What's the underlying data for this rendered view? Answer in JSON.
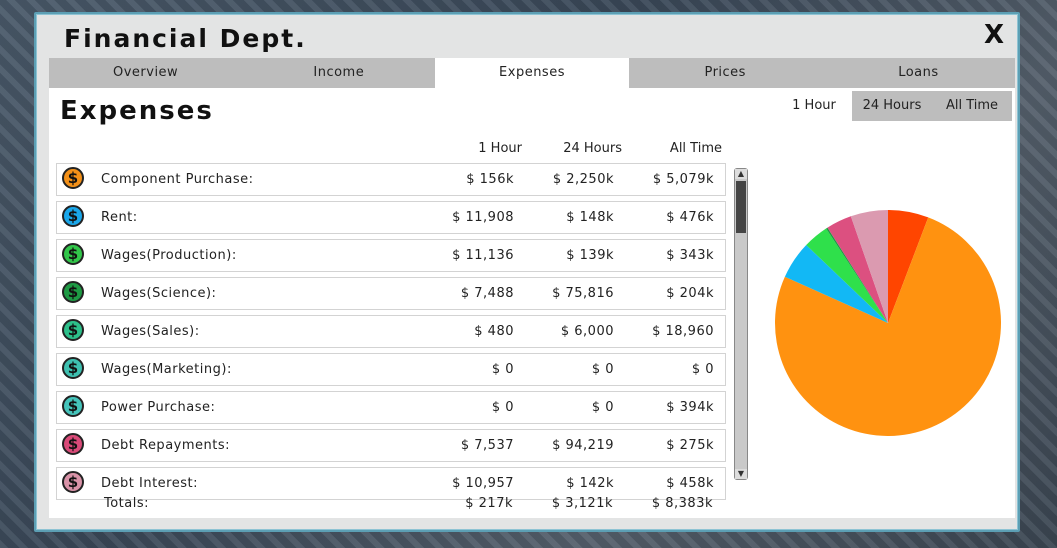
{
  "window": {
    "title": "Financial Dept.",
    "close_label": "X"
  },
  "tabs": [
    "Overview",
    "Income",
    "Expenses",
    "Prices",
    "Loans"
  ],
  "active_tab": "Expenses",
  "heading": "Expenses",
  "period_tabs": [
    "1 Hour",
    "24 Hours",
    "All Time"
  ],
  "active_period": "1 Hour",
  "columns": [
    "1 Hour",
    "24 Hours",
    "All Time"
  ],
  "rows": [
    {
      "label": "Component Purchase:",
      "icon_color": "#f39018",
      "v1": "$ 156k",
      "v2": "$ 2,250k",
      "v3": "$ 5,079k"
    },
    {
      "label": "Rent:",
      "icon_color": "#1aa7ea",
      "v1": "$ 11,908",
      "v2": "$ 148k",
      "v3": "$ 476k"
    },
    {
      "label": "Wages(Production):",
      "icon_color": "#32c64a",
      "v1": "$ 11,136",
      "v2": "$ 139k",
      "v3": "$ 343k"
    },
    {
      "label": "Wages(Science):",
      "icon_color": "#1e9a44",
      "v1": "$ 7,488",
      "v2": "$ 75,816",
      "v3": "$ 204k"
    },
    {
      "label": "Wages(Sales):",
      "icon_color": "#2dbf8a",
      "v1": "$ 480",
      "v2": "$ 6,000",
      "v3": "$ 18,960"
    },
    {
      "label": "Wages(Marketing):",
      "icon_color": "#3ec0b0",
      "v1": "$ 0",
      "v2": "$ 0",
      "v3": "$ 0"
    },
    {
      "label": "Power Purchase:",
      "icon_color": "#45c4bb",
      "v1": "$ 0",
      "v2": "$ 0",
      "v3": "$ 394k"
    },
    {
      "label": "Debt Repayments:",
      "icon_color": "#d94a78",
      "v1": "$ 7,537",
      "v2": "$ 94,219",
      "v3": "$ 275k"
    },
    {
      "label": "Debt Interest:",
      "icon_color": "#d993a8",
      "v1": "$ 10,957",
      "v2": "$ 142k",
      "v3": "$ 458k"
    }
  ],
  "totals": {
    "label": "Totals:",
    "v1": "$ 217k",
    "v2": "$ 3,121k",
    "v3": "$ 8,383k"
  },
  "chart_data": {
    "type": "pie",
    "slices": [
      {
        "label": "Rent",
        "value": 11908,
        "color": "#ff4500"
      },
      {
        "label": "Component Purchase",
        "value": 156000,
        "color": "#ff9210"
      },
      {
        "label": "Wages(Production)",
        "value": 11136,
        "color": "#12b8f5"
      },
      {
        "label": "Wages(Science)",
        "value": 7488,
        "color": "#2fe04b"
      },
      {
        "label": "Wages(Sales)",
        "value": 480,
        "color": "#1e9a44"
      },
      {
        "label": "Debt Repayments",
        "value": 7537,
        "color": "#dc5080"
      },
      {
        "label": "Debt Interest",
        "value": 10957,
        "color": "#db9ab0"
      }
    ]
  }
}
